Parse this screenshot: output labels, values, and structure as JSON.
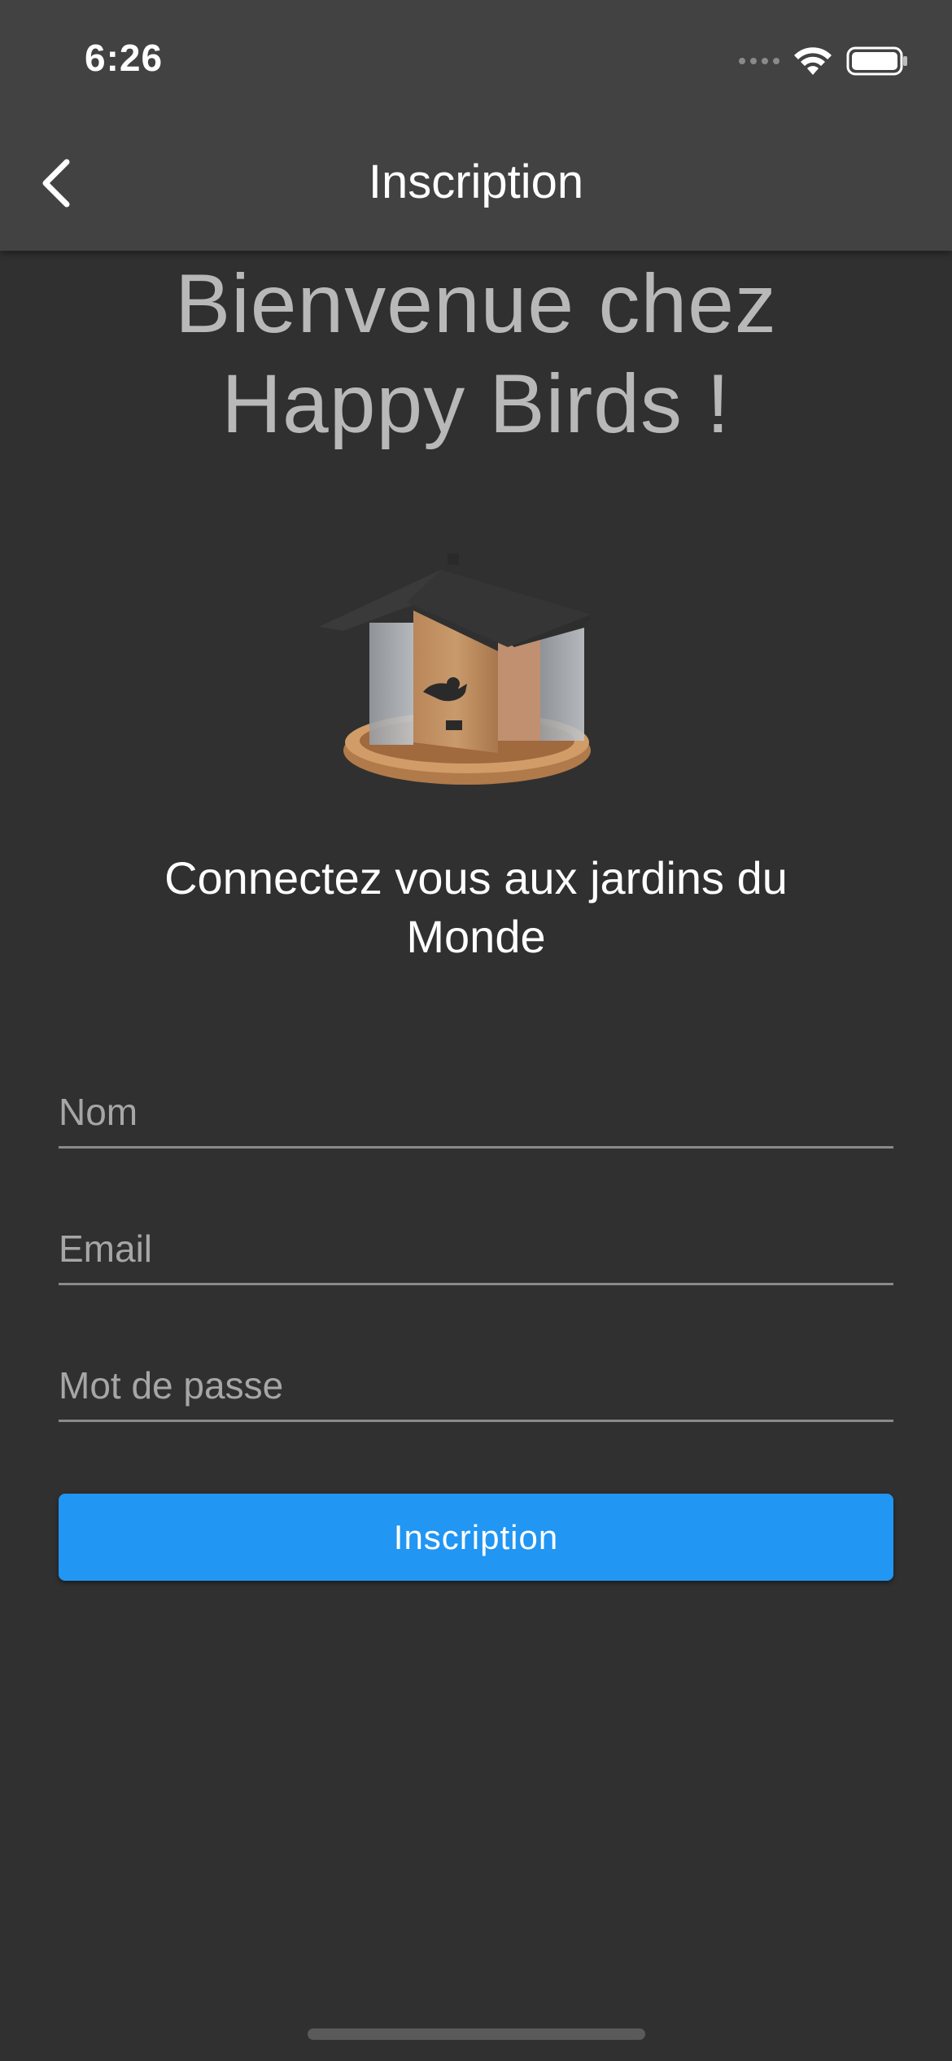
{
  "status_bar": {
    "time": "6:26",
    "icons": [
      "signal-dots-icon",
      "wifi-icon",
      "battery-icon"
    ]
  },
  "app_bar": {
    "back_icon": "chevron-left-icon",
    "title": "Inscription"
  },
  "main": {
    "welcome_line1": "Bienvenue chez",
    "welcome_line2": "Happy Birds !",
    "illustration": "bird-feeder-house-image",
    "subtitle": "Connectez vous aux jardins du Monde"
  },
  "form": {
    "name_placeholder": "Nom",
    "email_placeholder": "Email",
    "password_placeholder": "Mot de passe",
    "submit_label": "Inscription"
  },
  "colors": {
    "background": "#303030",
    "app_bar": "#424242",
    "accent": "#2196f3",
    "welcome_text": "#b8b8b8"
  }
}
